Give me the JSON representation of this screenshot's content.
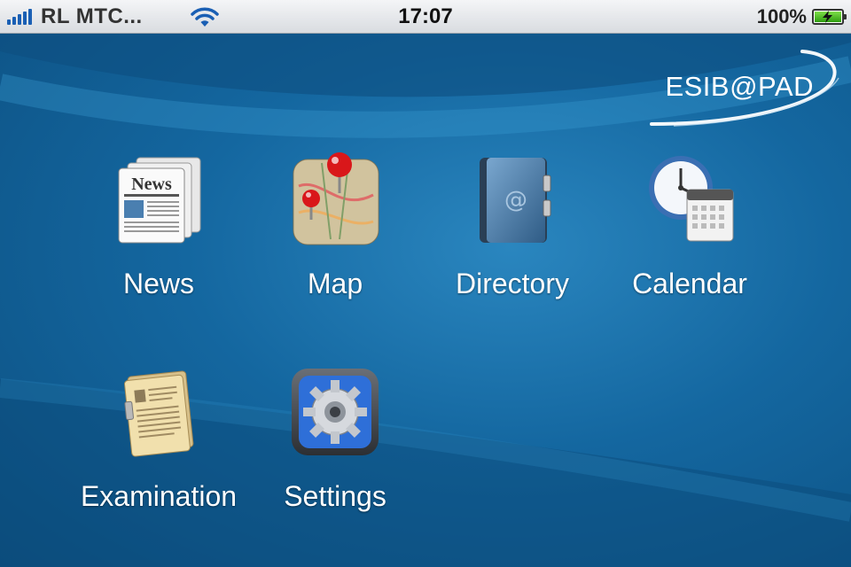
{
  "status_bar": {
    "carrier": "RL MTC...",
    "time": "17:07",
    "battery_percent": "100%",
    "battery_level": 1.0,
    "signal_bars": 5
  },
  "brand": {
    "title": "ESIB@PAD"
  },
  "apps": [
    {
      "label": "News",
      "icon": "newspaper-icon"
    },
    {
      "label": "Map",
      "icon": "map-pin-icon"
    },
    {
      "label": "Directory",
      "icon": "address-book-icon"
    },
    {
      "label": "Calendar",
      "icon": "clock-calendar-icon"
    },
    {
      "label": "Examination",
      "icon": "exam-document-icon"
    },
    {
      "label": "Settings",
      "icon": "gear-icon"
    }
  ],
  "colors": {
    "background": "#1467a0",
    "status_bar": "#e6e8eb",
    "accent_text": "#ffffff"
  }
}
